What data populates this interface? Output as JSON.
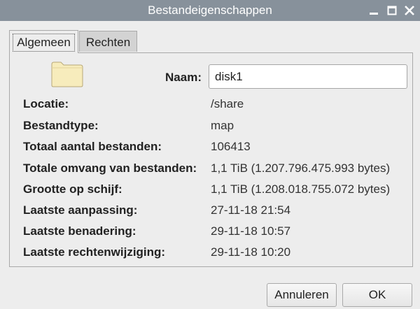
{
  "window": {
    "title": "Bestandeigenschappen"
  },
  "tabs": [
    {
      "label": "Algemeen",
      "active": true
    },
    {
      "label": "Rechten",
      "active": false
    }
  ],
  "name_field": {
    "label": "Naam:",
    "value": "disk1"
  },
  "properties": [
    {
      "label": "Locatie:",
      "value": "/share"
    },
    {
      "label": "Bestandtype:",
      "value": "map"
    },
    {
      "label": "Totaal aantal bestanden:",
      "value": "106413"
    },
    {
      "label": "Totale omvang van bestanden:",
      "value": "1,1 TiB (1.207.796.475.993 bytes)"
    },
    {
      "label": "Grootte op schijf:",
      "value": "1,1 TiB (1.208.018.755.072 bytes)"
    },
    {
      "label": "Laatste aanpassing:",
      "value": "27-11-18 21:54"
    },
    {
      "label": "Laatste benadering:",
      "value": "29-11-18 10:57"
    },
    {
      "label": "Laatste rechtenwijziging:",
      "value": "29-11-18 10:20"
    }
  ],
  "buttons": {
    "cancel": "Annuleren",
    "ok": "OK"
  },
  "icons": {
    "folder": "folder-icon",
    "minimize": "minimize-icon",
    "maximize": "maximize-icon",
    "close": "close-icon"
  },
  "colors": {
    "titlebar": "#87919b",
    "folder": "#f7ecbc"
  }
}
